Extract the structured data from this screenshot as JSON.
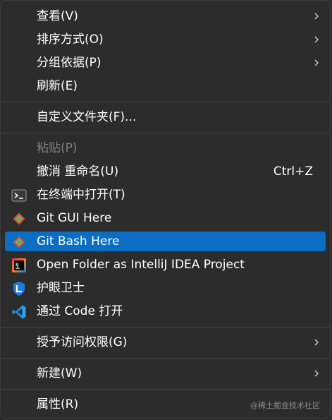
{
  "menu": {
    "view": {
      "label": "查看(V)"
    },
    "sort": {
      "label": "排序方式(O)"
    },
    "group": {
      "label": "分组依据(P)"
    },
    "refresh": {
      "label": "刷新(E)"
    },
    "customize_folder": {
      "label": "自定义文件夹(F)..."
    },
    "paste": {
      "label": "粘贴(P)"
    },
    "undo_rename": {
      "label": "撤消 重命名(U)",
      "shortcut": "Ctrl+Z"
    },
    "open_terminal": {
      "label": "在终端中打开(T)",
      "icon": "terminal-icon"
    },
    "git_gui": {
      "label": "Git GUI Here",
      "icon": "git-gui-icon"
    },
    "git_bash": {
      "label": "Git Bash Here",
      "icon": "git-bash-icon"
    },
    "intellij": {
      "label": "Open Folder as IntelliJ IDEA Project",
      "icon": "intellij-icon"
    },
    "eye_guard": {
      "label": "护眼卫士",
      "icon": "eye-guard-icon"
    },
    "vscode": {
      "label": "通过 Code 打开",
      "icon": "vscode-icon"
    },
    "grant_access": {
      "label": "授予访问权限(G)"
    },
    "new": {
      "label": "新建(W)"
    },
    "properties": {
      "label": "属性(R)"
    }
  },
  "colors": {
    "background": "#2c2c2c",
    "highlight": "#0b6ec4",
    "text": "#ffffff",
    "disabled_text": "#7f7f7f",
    "separator": "#444444"
  },
  "watermark": "@稀土掘金技术社区"
}
